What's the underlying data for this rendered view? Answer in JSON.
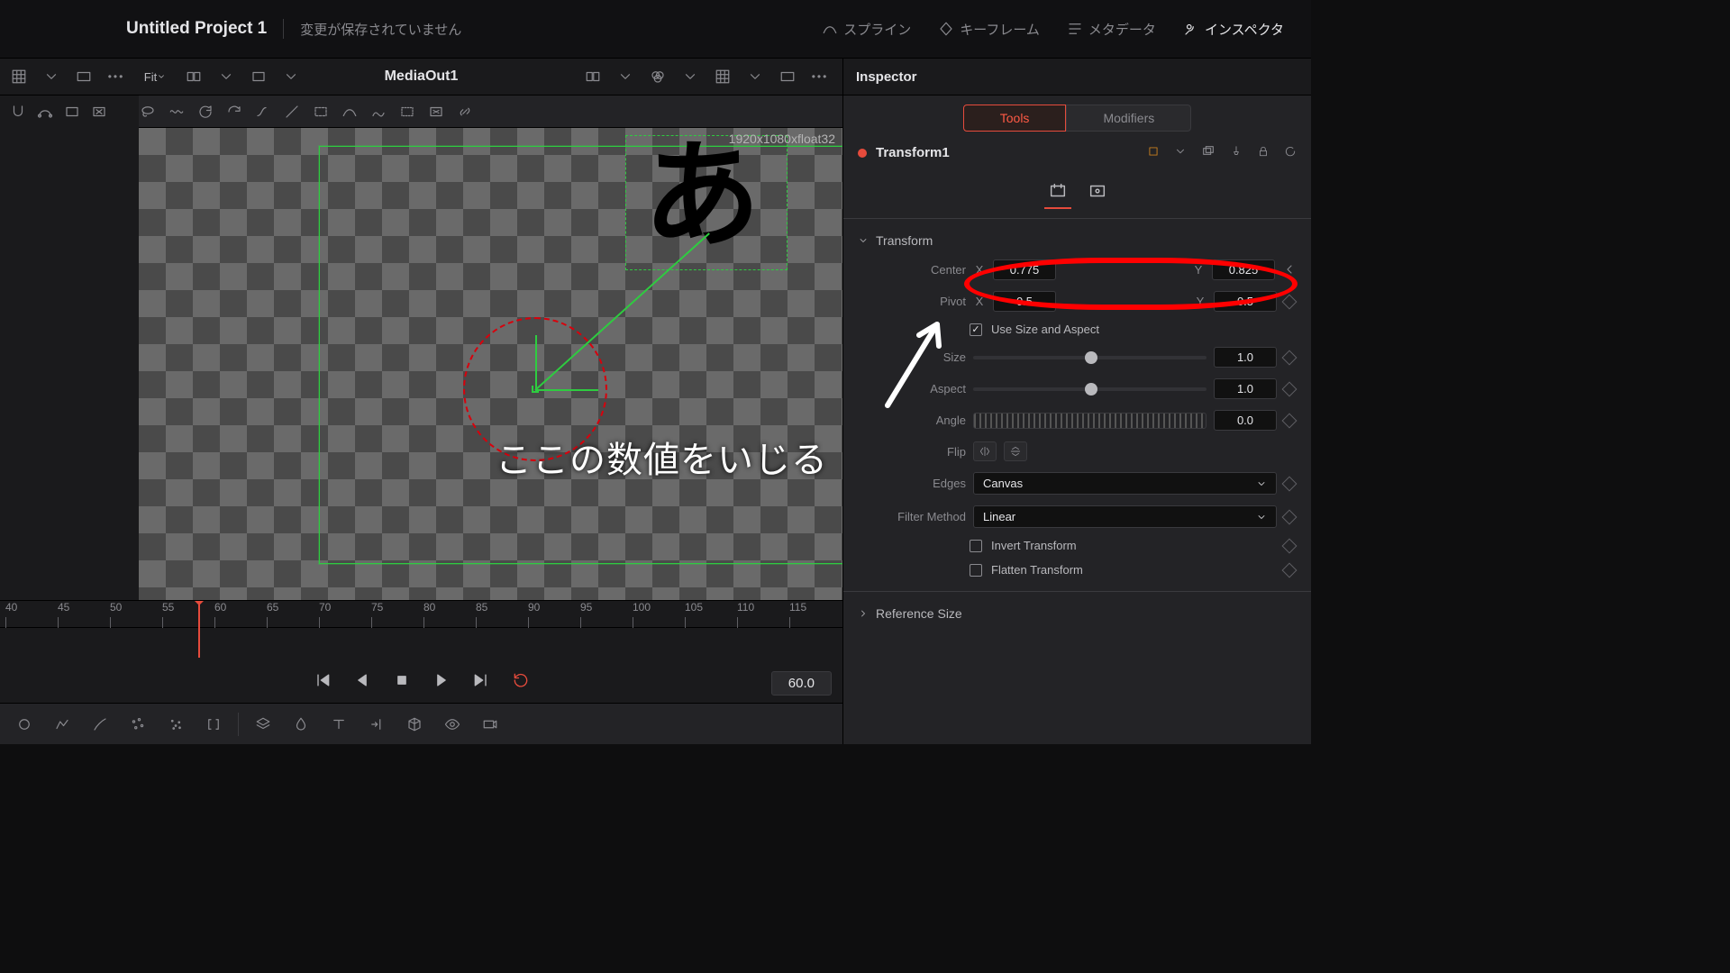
{
  "title": {
    "project": "Untitled Project 1",
    "dirty": "変更が保存されていません"
  },
  "topbar": {
    "spline": "スプライン",
    "keyframe": "キーフレーム",
    "metadata": "メタデータ",
    "inspector": "インスペクタ"
  },
  "row2": {
    "fit": "Fit",
    "media": "MediaOut1",
    "inspector": "Inspector"
  },
  "viewer": {
    "res": "1920x1080xfloat32",
    "glyph": "あ"
  },
  "timeline": {
    "ticks": [
      "40",
      "45",
      "50",
      "55",
      "60",
      "65",
      "70",
      "75",
      "80",
      "85",
      "90",
      "95",
      "100",
      "105",
      "110",
      "115"
    ],
    "fps": "60.0",
    "playhead": "60"
  },
  "inspector": {
    "tabs": {
      "tools": "Tools",
      "modifiers": "Modifiers"
    },
    "node": "Transform1",
    "sections": {
      "transform": "Transform",
      "refsize": "Reference Size"
    },
    "labels": {
      "center": "Center",
      "pivot": "Pivot",
      "useSize": "Use Size and Aspect",
      "size": "Size",
      "aspect": "Aspect",
      "angle": "Angle",
      "flip": "Flip",
      "edges": "Edges",
      "filter": "Filter Method",
      "invert": "Invert Transform",
      "flatten": "Flatten Transform"
    },
    "values": {
      "centerX": "0.775",
      "centerY": "0.825",
      "pivotX": "0.5",
      "pivotY": "0.5",
      "size": "1.0",
      "aspect": "1.0",
      "angle": "0.0",
      "edges": "Canvas",
      "filter": "Linear"
    },
    "axes": {
      "x": "X",
      "y": "Y"
    }
  },
  "annot": {
    "text": "ここの数値をいじる"
  }
}
